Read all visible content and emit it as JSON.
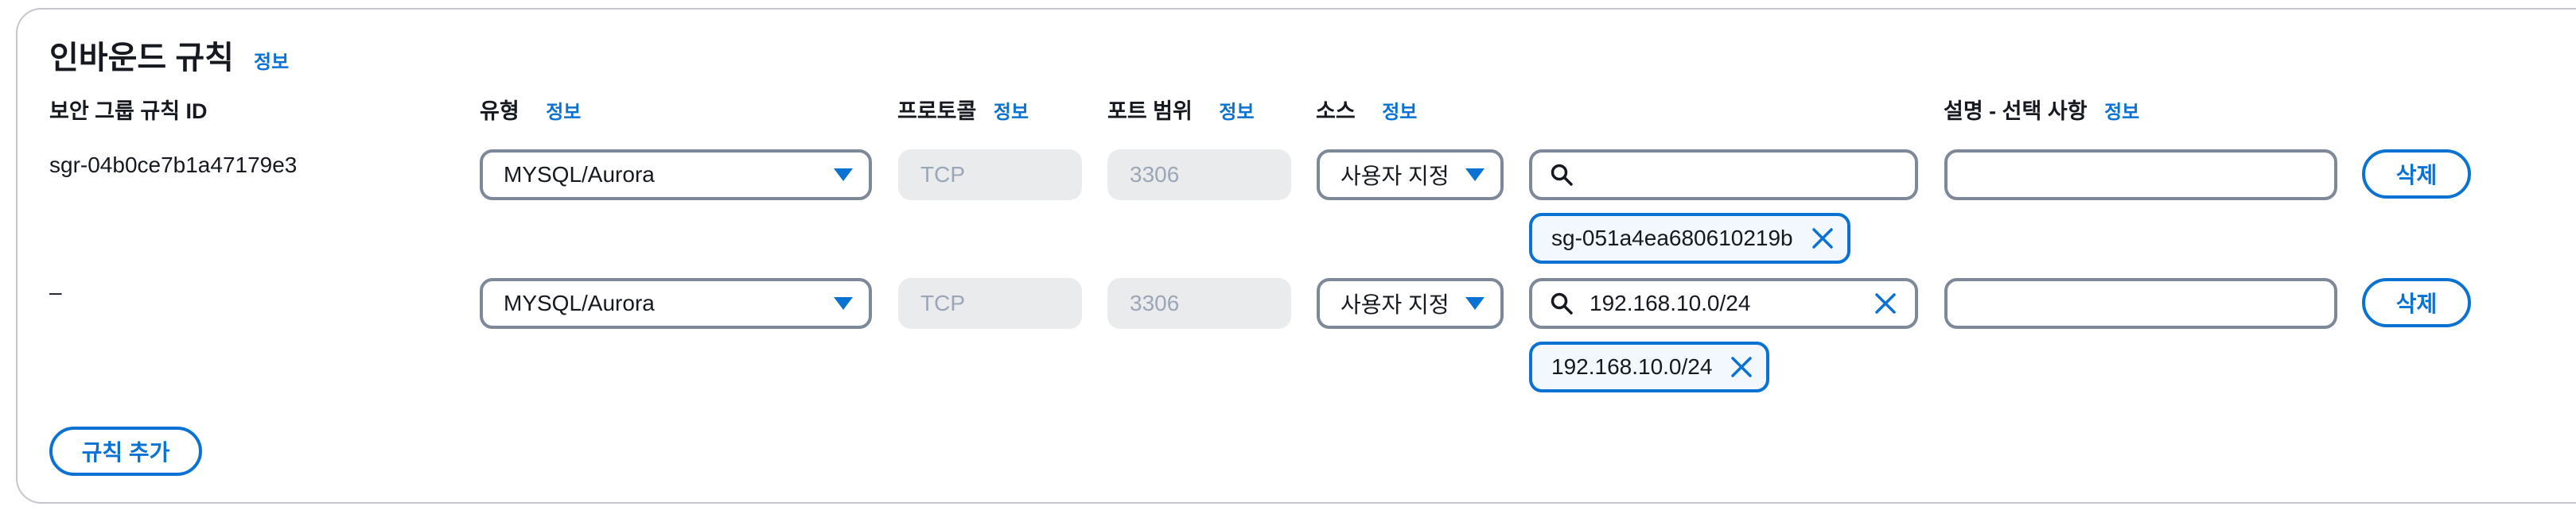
{
  "section": {
    "title": "인바운드 규칙",
    "info": "정보"
  },
  "columns": {
    "rule_id": "보안 그룹 규칙 ID",
    "type": "유형",
    "type_info": "정보",
    "protocol": "프로토콜",
    "protocol_info": "정보",
    "port_range": "포트 범위",
    "port_range_info": "정보",
    "source": "소스",
    "source_info": "정보",
    "description": "설명 - 선택 사항",
    "description_info": "정보"
  },
  "rules": [
    {
      "id": "sgr-04b0ce7b1a47179e3",
      "type": "MYSQL/Aurora",
      "protocol": "TCP",
      "port": "3306",
      "source_type": "사용자 지정",
      "search_value": "",
      "token": "sg-051a4ea680610219b",
      "description": "",
      "delete_label": "삭제"
    },
    {
      "id": "–",
      "type": "MYSQL/Aurora",
      "protocol": "TCP",
      "port": "3306",
      "source_type": "사용자 지정",
      "search_value": "192.168.10.0/24",
      "token": "192.168.10.0/24",
      "description": "",
      "delete_label": "삭제"
    }
  ],
  "add_rule_label": "규칙 추가",
  "icons": {
    "search": "search-icon",
    "clear": "close-icon",
    "dropdown": "caret-down-icon",
    "remove_token": "close-icon"
  },
  "colors": {
    "accent": "#0972d3",
    "text": "#16191f",
    "border": "#7d8998",
    "disabled_bg": "#e9ebed",
    "disabled_text": "#9ba7b6",
    "token_bg": "#f2f8fd"
  }
}
